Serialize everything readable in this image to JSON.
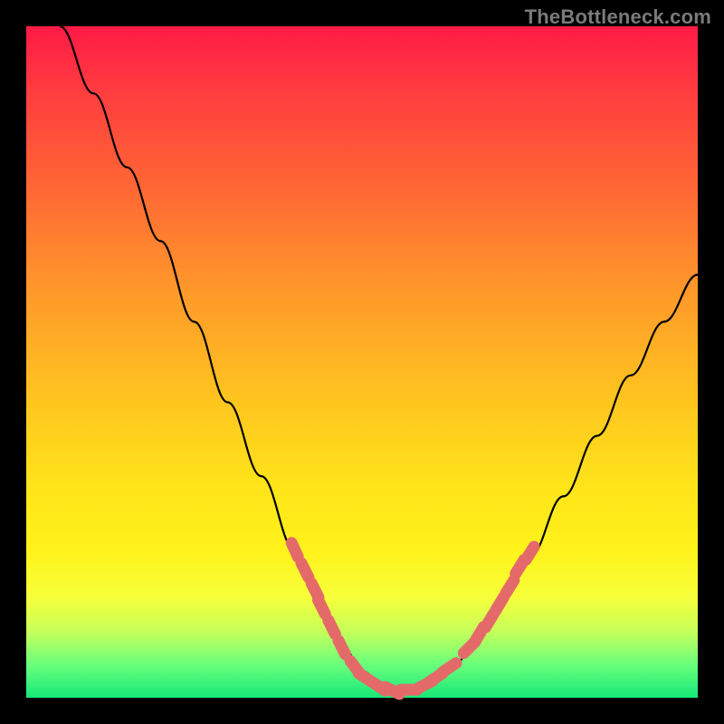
{
  "watermark": "TheBottleneck.com",
  "colors": {
    "marker": "#e46a6a",
    "curve": "#000000",
    "frame_bg_top": "#ff1a46",
    "frame_bg_bottom": "#17e87a",
    "outer_bg": "#000000"
  },
  "chart_data": {
    "type": "line",
    "title": "",
    "xlabel": "",
    "ylabel": "",
    "xlim": [
      0,
      100
    ],
    "ylim": [
      0,
      100
    ],
    "grid": false,
    "legend": false,
    "series": [
      {
        "name": "bottleneck-curve",
        "x": [
          5,
          10,
          15,
          20,
          25,
          30,
          35,
          40,
          45,
          47,
          50,
          53,
          55,
          58,
          60,
          63,
          67,
          70,
          75,
          80,
          85,
          90,
          95,
          100
        ],
        "y": [
          100,
          90,
          79,
          68,
          56,
          44,
          33,
          22,
          12,
          8,
          4,
          2,
          1,
          1,
          2,
          4,
          8,
          13,
          21,
          30,
          39,
          48,
          56,
          63
        ]
      }
    ],
    "markers": [
      {
        "x": 40,
        "y": 22
      },
      {
        "x": 41.5,
        "y": 19
      },
      {
        "x": 43,
        "y": 16
      },
      {
        "x": 44,
        "y": 13.5
      },
      {
        "x": 45.5,
        "y": 10.5
      },
      {
        "x": 47,
        "y": 7.5
      },
      {
        "x": 49,
        "y": 4.5
      },
      {
        "x": 50.5,
        "y": 3
      },
      {
        "x": 52.5,
        "y": 1.7
      },
      {
        "x": 54.5,
        "y": 1.1
      },
      {
        "x": 57,
        "y": 1.2
      },
      {
        "x": 59.5,
        "y": 2
      },
      {
        "x": 61,
        "y": 3
      },
      {
        "x": 63,
        "y": 4.5
      },
      {
        "x": 66,
        "y": 7.5
      },
      {
        "x": 67.5,
        "y": 9.5
      },
      {
        "x": 69,
        "y": 11.5
      },
      {
        "x": 70.5,
        "y": 14
      },
      {
        "x": 72,
        "y": 16.5
      },
      {
        "x": 73.5,
        "y": 19.5
      },
      {
        "x": 75,
        "y": 21.5
      }
    ]
  }
}
